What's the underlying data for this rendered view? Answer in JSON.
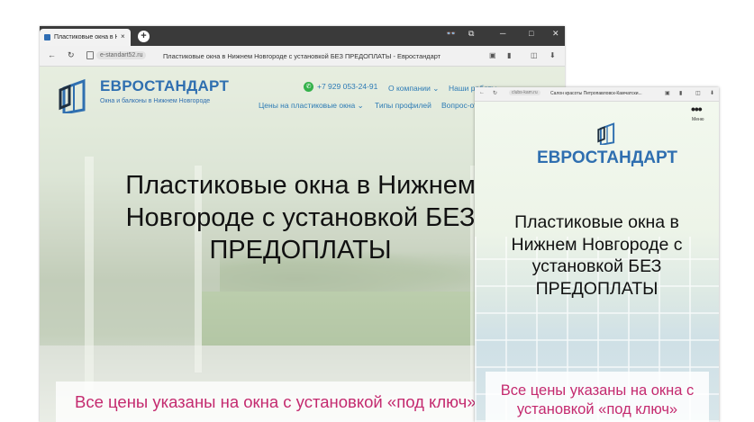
{
  "desktop": {
    "tab_title": "Пластиковые окна в Ни",
    "tab_close": "×",
    "new_tab": "+",
    "domain": "e-standart52.ru",
    "page_title": "Пластиковые окна в Нижнем Новгороде с установкой БЕЗ ПРЕДОПЛАТЫ - Евростандарт",
    "brand": "ЕВРОСТАНДАРТ",
    "tagline": "Окна и балконы в Нижнем Новгороде",
    "phone": "+7 929 053-24-91",
    "menu_top": [
      "О компании",
      "Наши работы"
    ],
    "menu_bottom": [
      "Цены на пластиковые окна",
      "Типы профилей",
      "Вопрос-ответ"
    ],
    "hero": "Пластиковые окна в Нижнем Новгороде с установкой БЕЗ ПРЕДОПЛАТЫ",
    "band": "Все цены указаны на окна с установкой «под ключ»"
  },
  "mobile": {
    "domain": "clubs-kam.ru",
    "page_title": "Салон красоты Петропавловск-Камчатски...",
    "menu_label": "Меню",
    "brand": "ЕВРОСТАНДАРТ",
    "hero": "Пластиковые окна в Нижнем Новгороде с установкой БЕЗ ПРЕДОПЛАТЫ",
    "band": "Все цены указаны на окна с установкой «под ключ»"
  },
  "colors": {
    "brand_blue": "#2f6fb0",
    "link_blue": "#2d7bb5",
    "accent_pink": "#c42a6f",
    "whatsapp_green": "#34b14a"
  }
}
